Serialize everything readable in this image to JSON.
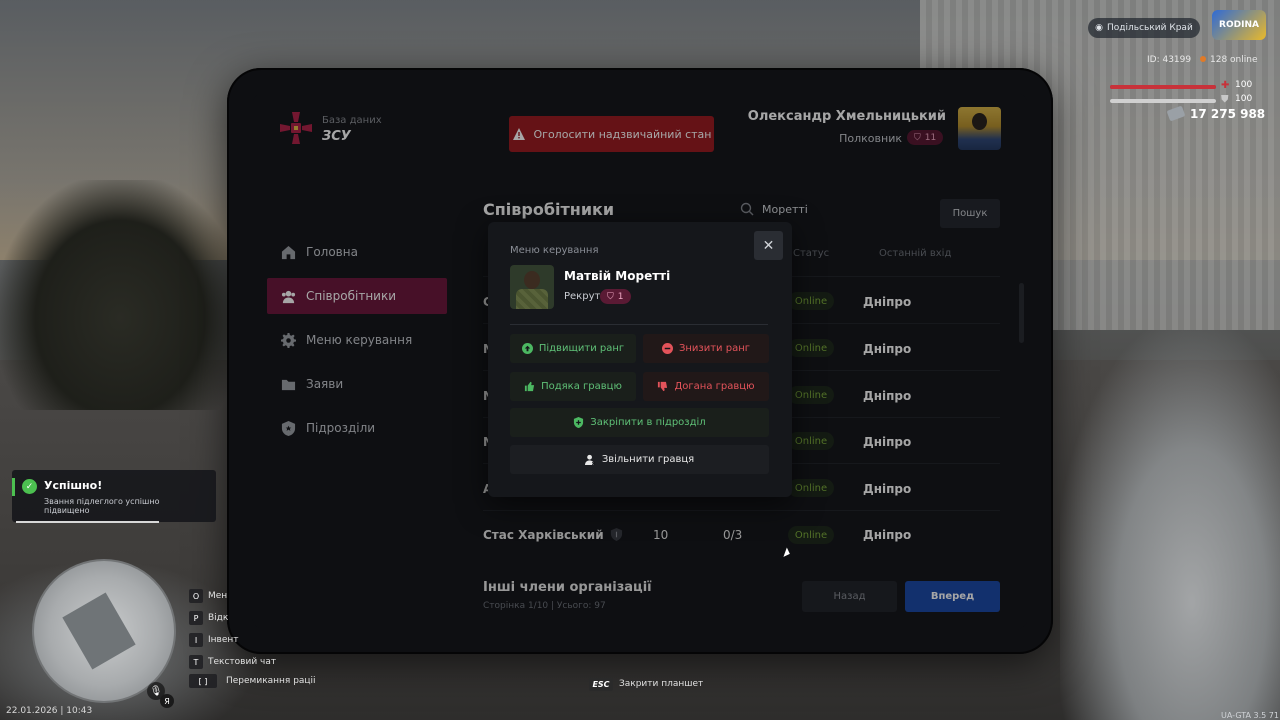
{
  "hud": {
    "server_name": "Подільський Край",
    "server_logo_text": "RODINA",
    "player_id": "ID: 43199",
    "online": "128 online",
    "health": "100",
    "armor": "100",
    "money": "17 275 988",
    "health_fraction": 1.0,
    "armor_fraction": 1.0,
    "health_color": "#c8323a",
    "armor_color": "#d0d0d0"
  },
  "tablet": {
    "brand_small": "База даних",
    "brand_big": "ЗСУ",
    "emergency_label": "Оголосити надзвичайний стан",
    "user_name": "Олександр Хмельницький",
    "user_rank": "Полковник",
    "user_rank_level": "11",
    "accent_color": "#6e1a3e",
    "sidebar": [
      {
        "label": "Головна",
        "icon": "home-icon"
      },
      {
        "label": "Співробітники",
        "icon": "users-icon",
        "active": true
      },
      {
        "label": "Меню керування",
        "icon": "gear-icon"
      },
      {
        "label": "Заяви",
        "icon": "folder-icon"
      },
      {
        "label": "Підрозділи",
        "icon": "shield-icon"
      }
    ],
    "main": {
      "title": "Співробітники",
      "search_value": "Моретті",
      "search_button": "Пошук",
      "columns": {
        "status": "Статус",
        "last_login": "Останній вхід"
      },
      "rows": [
        {
          "initial": "С",
          "status": "Online",
          "city": "Дніпро"
        },
        {
          "initial": "N",
          "status": "Online",
          "city": "Дніпро"
        },
        {
          "initial": "N",
          "status": "Online",
          "city": "Дніпро"
        },
        {
          "initial": "N",
          "status": "Online",
          "city": "Дніпро"
        },
        {
          "initial": "A",
          "status": "Online",
          "city": "Дніпро"
        },
        {
          "name": "Стас Харківський",
          "rank": "10",
          "warnings": "0/3",
          "status": "Online",
          "city": "Дніпро"
        }
      ],
      "others_title": "Інші члени організації",
      "others_sub": "Сторінка 1/10 | Усього: 97",
      "back_label": "Назад",
      "next_label": "Вперед"
    },
    "modal": {
      "header": "Меню керування",
      "member_name": "Матвій Моретті",
      "member_rank": "Рекрут",
      "member_rank_level": "1",
      "buttons": {
        "promote": "Підвищити ранг",
        "demote": "Знизити ранг",
        "thanks": "Подяка гравцю",
        "reprimand": "Догана гравцю",
        "assign": "Закріпити в підрозділ",
        "fire": "Звільнити гравця"
      }
    }
  },
  "toast": {
    "title": "Успішно!",
    "text": "Звання підлеглого успішно підвищено"
  },
  "keys": [
    {
      "key": "O",
      "label": "Мен"
    },
    {
      "key": "P",
      "label": "Відк"
    },
    {
      "key": "I",
      "label": "Інвент"
    },
    {
      "key": "T",
      "label": "Текстовий чат"
    },
    {
      "key": "[ ]",
      "label": "Перемикання раціі"
    }
  ],
  "datetime": "22.01.2026 | 10:43",
  "esc": {
    "key": "ESC",
    "label": "Закрити планшет"
  },
  "mic_lang": "Я",
  "version": "UA-GTA 3.5  71"
}
